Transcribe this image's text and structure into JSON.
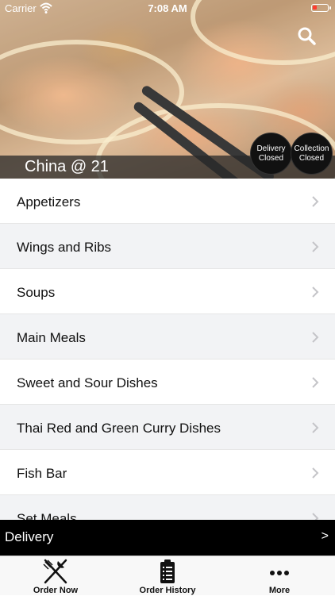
{
  "status_bar": {
    "carrier": "Carrier",
    "time": "7:08 AM"
  },
  "header": {
    "restaurant_name": "China @ 21",
    "search_icon": "search-icon",
    "delivery_status": {
      "line1": "Delivery",
      "line2": "Closed"
    },
    "collection_status": {
      "line1": "Collection",
      "line2": "Closed"
    }
  },
  "menu": {
    "categories": [
      {
        "label": "Appetizers"
      },
      {
        "label": "Wings and Ribs"
      },
      {
        "label": "Soups"
      },
      {
        "label": "Main Meals"
      },
      {
        "label": "Sweet and Sour Dishes"
      },
      {
        "label": "Thai Red and Green Curry Dishes"
      },
      {
        "label": "Fish Bar"
      },
      {
        "label": "Set Meals"
      }
    ]
  },
  "delivery_bar": {
    "label": "Delivery",
    "arrow": ">"
  },
  "tabs": [
    {
      "label": "Order Now",
      "icon": "fork-knife-icon"
    },
    {
      "label": "Order History",
      "icon": "clipboard-list-icon"
    },
    {
      "label": "More",
      "icon": "more-dots-icon"
    }
  ]
}
